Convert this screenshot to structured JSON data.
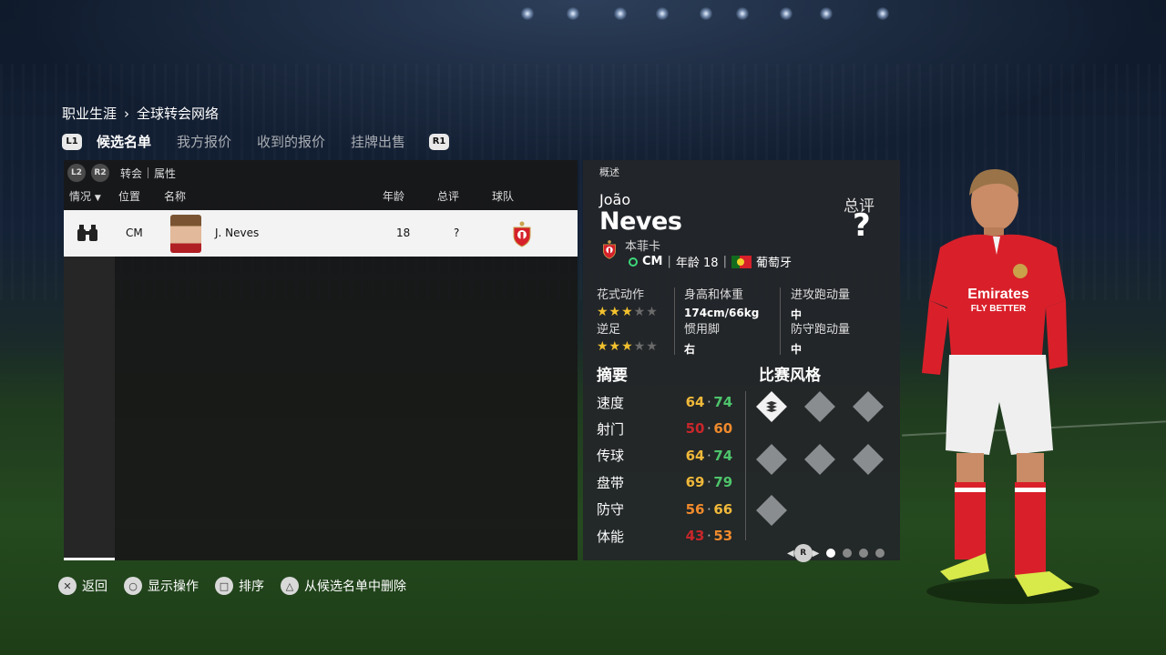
{
  "breadcrumb": {
    "root": "职业生涯",
    "current": "全球转会网络"
  },
  "tabs": {
    "left_button": "L1",
    "right_button": "R1",
    "items": [
      "候选名单",
      "我方报价",
      "收到的报价",
      "挂牌出售"
    ],
    "active": "候选名单"
  },
  "filters": {
    "l2": "L2",
    "r2": "R2",
    "options": [
      "转会",
      "属性"
    ]
  },
  "table": {
    "columns": [
      "情况",
      "位置",
      "名称",
      "年龄",
      "总评",
      "球队"
    ],
    "rows": [
      {
        "status_icon": "binoculars-icon",
        "position": "CM",
        "name": "J. Neves",
        "age": "18",
        "ovr": "?",
        "club_icon": "benfica-badge"
      }
    ]
  },
  "overview": {
    "section_label": "概述",
    "first_name": "João",
    "last_name": "Neves",
    "ovr_label": "总评",
    "ovr_value": "?",
    "club": "本菲卡",
    "position": "CM",
    "age_text": "年龄 18",
    "nationality": "葡萄牙",
    "attributes": {
      "skill_moves": {
        "label": "花式动作",
        "stars": 3,
        "max": 5
      },
      "weak_foot": {
        "label": "逆足",
        "stars": 3,
        "max": 5
      },
      "height_weight": {
        "label": "身高和体重",
        "value": "174cm/66kg"
      },
      "preferred_foot": {
        "label": "惯用脚",
        "value": "右"
      },
      "attack_work_rate": {
        "label": "进攻跑动量",
        "value": "中"
      },
      "defense_work_rate": {
        "label": "防守跑动量",
        "value": "中"
      }
    },
    "summary_title": "摘要",
    "playstyle_title": "比赛风格",
    "stats": [
      {
        "name": "速度",
        "current": "64",
        "potential": "74",
        "cur_color": "#f0b93a",
        "pot_color": "#4ec46b"
      },
      {
        "name": "射门",
        "current": "50",
        "potential": "60",
        "cur_color": "#c8262b",
        "pot_color": "#f08a2c"
      },
      {
        "name": "传球",
        "current": "64",
        "potential": "74",
        "cur_color": "#f0b93a",
        "pot_color": "#4ec46b"
      },
      {
        "name": "盘带",
        "current": "69",
        "potential": "79",
        "cur_color": "#f0b93a",
        "pot_color": "#4ec46b"
      },
      {
        "name": "防守",
        "current": "56",
        "potential": "66",
        "cur_color": "#f08a2c",
        "pot_color": "#f0b93a"
      },
      {
        "name": "体能",
        "current": "43",
        "potential": "53",
        "cur_color": "#c8262b",
        "pot_color": "#f08a2c"
      }
    ],
    "pager": {
      "button": "R",
      "pages": 4,
      "active_page": 1
    }
  },
  "prompts": [
    {
      "icon": "cross-button-icon",
      "label": "返回"
    },
    {
      "icon": "circle-button-icon",
      "label": "显示操作"
    },
    {
      "icon": "square-button-icon",
      "label": "排序"
    },
    {
      "icon": "triangle-button-icon",
      "label": "从候选名单中删除"
    }
  ],
  "colors": {
    "club_red": "#d6202a",
    "star": "#f2c12e",
    "active_row": "#f3f3f3"
  }
}
